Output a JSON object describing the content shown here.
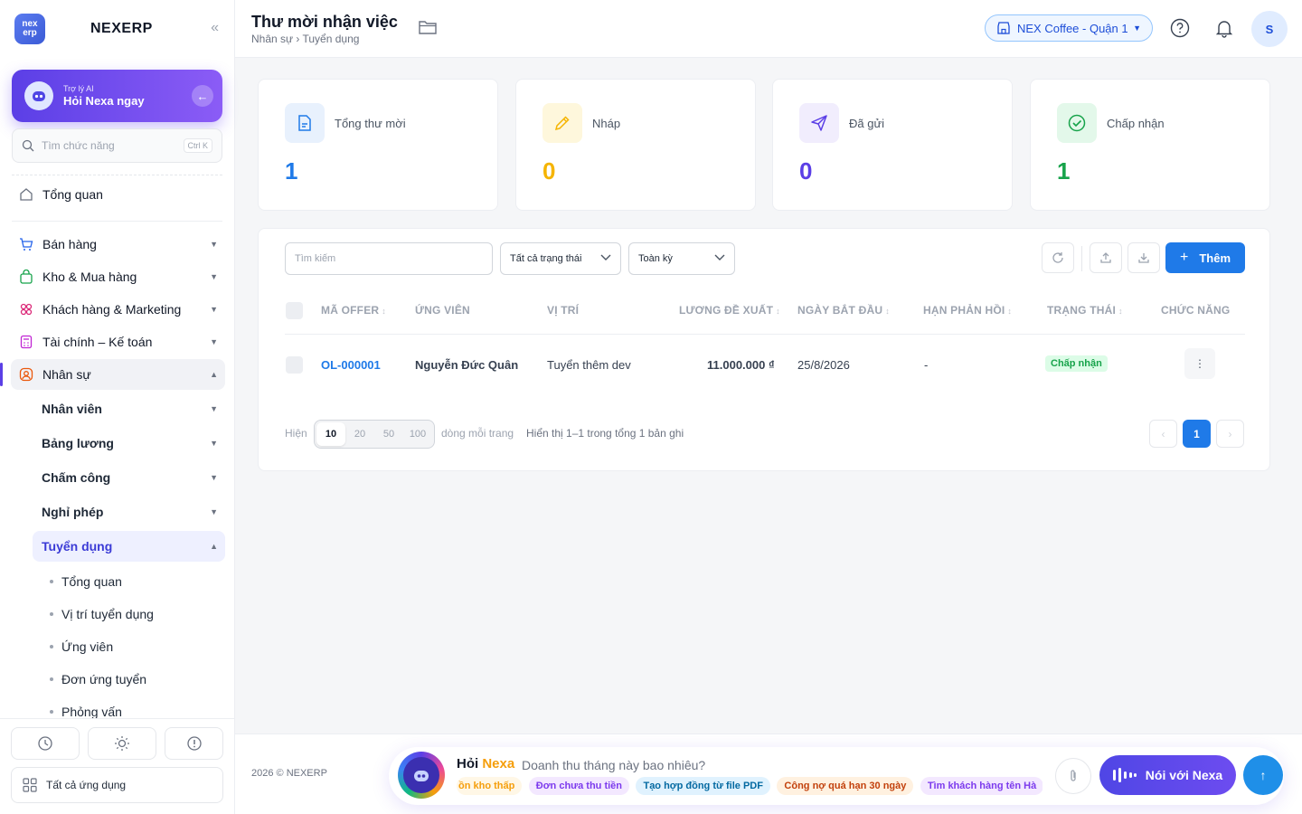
{
  "brand": {
    "logo_line1": "nex",
    "logo_line2": "erp",
    "name": "NEXERP"
  },
  "ai_card": {
    "small": "Trợ lý AI",
    "big": "Hỏi Nexa ngay"
  },
  "side_search": {
    "placeholder": "Tìm chức năng",
    "shortcut": "Ctrl K"
  },
  "nav": {
    "overview": "Tổng quan",
    "sales": "Bán hàng",
    "warehouse": "Kho & Mua hàng",
    "customers": "Khách hàng & Marketing",
    "finance": "Tài chính – Kế toán",
    "hr": "Nhân sự",
    "hr_sub": [
      "Nhân viên",
      "Bảng lương",
      "Chấm công",
      "Nghỉ phép",
      "Tuyển dụng"
    ],
    "recruit_sub": [
      "Tổng quan",
      "Vị trí tuyển dụng",
      "Ứng viên",
      "Đơn ứng tuyển",
      "Phỏng vấn"
    ],
    "all_apps": "Tất cả ứng dụng"
  },
  "header": {
    "title": "Thư mời nhận việc",
    "breadcrumb": "Nhân sự › Tuyển dụng",
    "store": "NEX Coffee - Quận 1",
    "avatar_initial": "S"
  },
  "stats": [
    {
      "label": "Tổng thư mời",
      "value": "1",
      "color": "#1f7ae8"
    },
    {
      "label": "Nháp",
      "value": "0",
      "color": "#f5b400"
    },
    {
      "label": "Đã gửi",
      "value": "0",
      "color": "#5b3fe6"
    },
    {
      "label": "Chấp nhận",
      "value": "1",
      "color": "#16a34a"
    }
  ],
  "toolbar": {
    "search_placeholder": "Tìm kiếm",
    "status_filter": "Tất cả trạng thái",
    "period_filter": "Toàn kỳ",
    "add_label": "Thêm"
  },
  "table": {
    "columns": [
      "MÃ OFFER",
      "ỨNG VIÊN",
      "VỊ TRÍ",
      "LƯƠNG ĐỀ XUẤT",
      "NGÀY BẮT ĐẦU",
      "HẠN PHẢN HỒI",
      "TRẠNG THÁI",
      "CHỨC NĂNG"
    ],
    "rows": [
      {
        "code": "OL-000001",
        "candidate": "Nguyễn Đức Quân",
        "position": "Tuyển thêm dev",
        "salary": "11.000.000 ₫",
        "start": "25/8/2026",
        "deadline": "-",
        "status": "Chấp nhận"
      }
    ]
  },
  "pagination": {
    "show": "Hiện",
    "sizes": [
      "10",
      "20",
      "50",
      "100"
    ],
    "per_page": "dòng mỗi trang",
    "summary": "Hiển thị 1–1 trong tổng 1 bản ghi",
    "current": "1"
  },
  "footer": {
    "copyright": "2026 © NEXERP",
    "ask_prefix": "Hỏi",
    "ask_name": "Nexa",
    "ask_question": "Doanh thu tháng này bao nhiêu?",
    "chips": [
      "ồn kho thấp",
      "Đơn chưa thu tiền",
      "Tạo hợp đồng từ file PDF",
      "Công nợ quá hạn 30 ngày",
      "Tìm khách hàng tên Hà"
    ],
    "talk_label": "Nói với Nexa"
  },
  "colors": {
    "accent": "#1f7ae8",
    "ai_purple": "#5b3fe6",
    "success": "#16a34a"
  }
}
